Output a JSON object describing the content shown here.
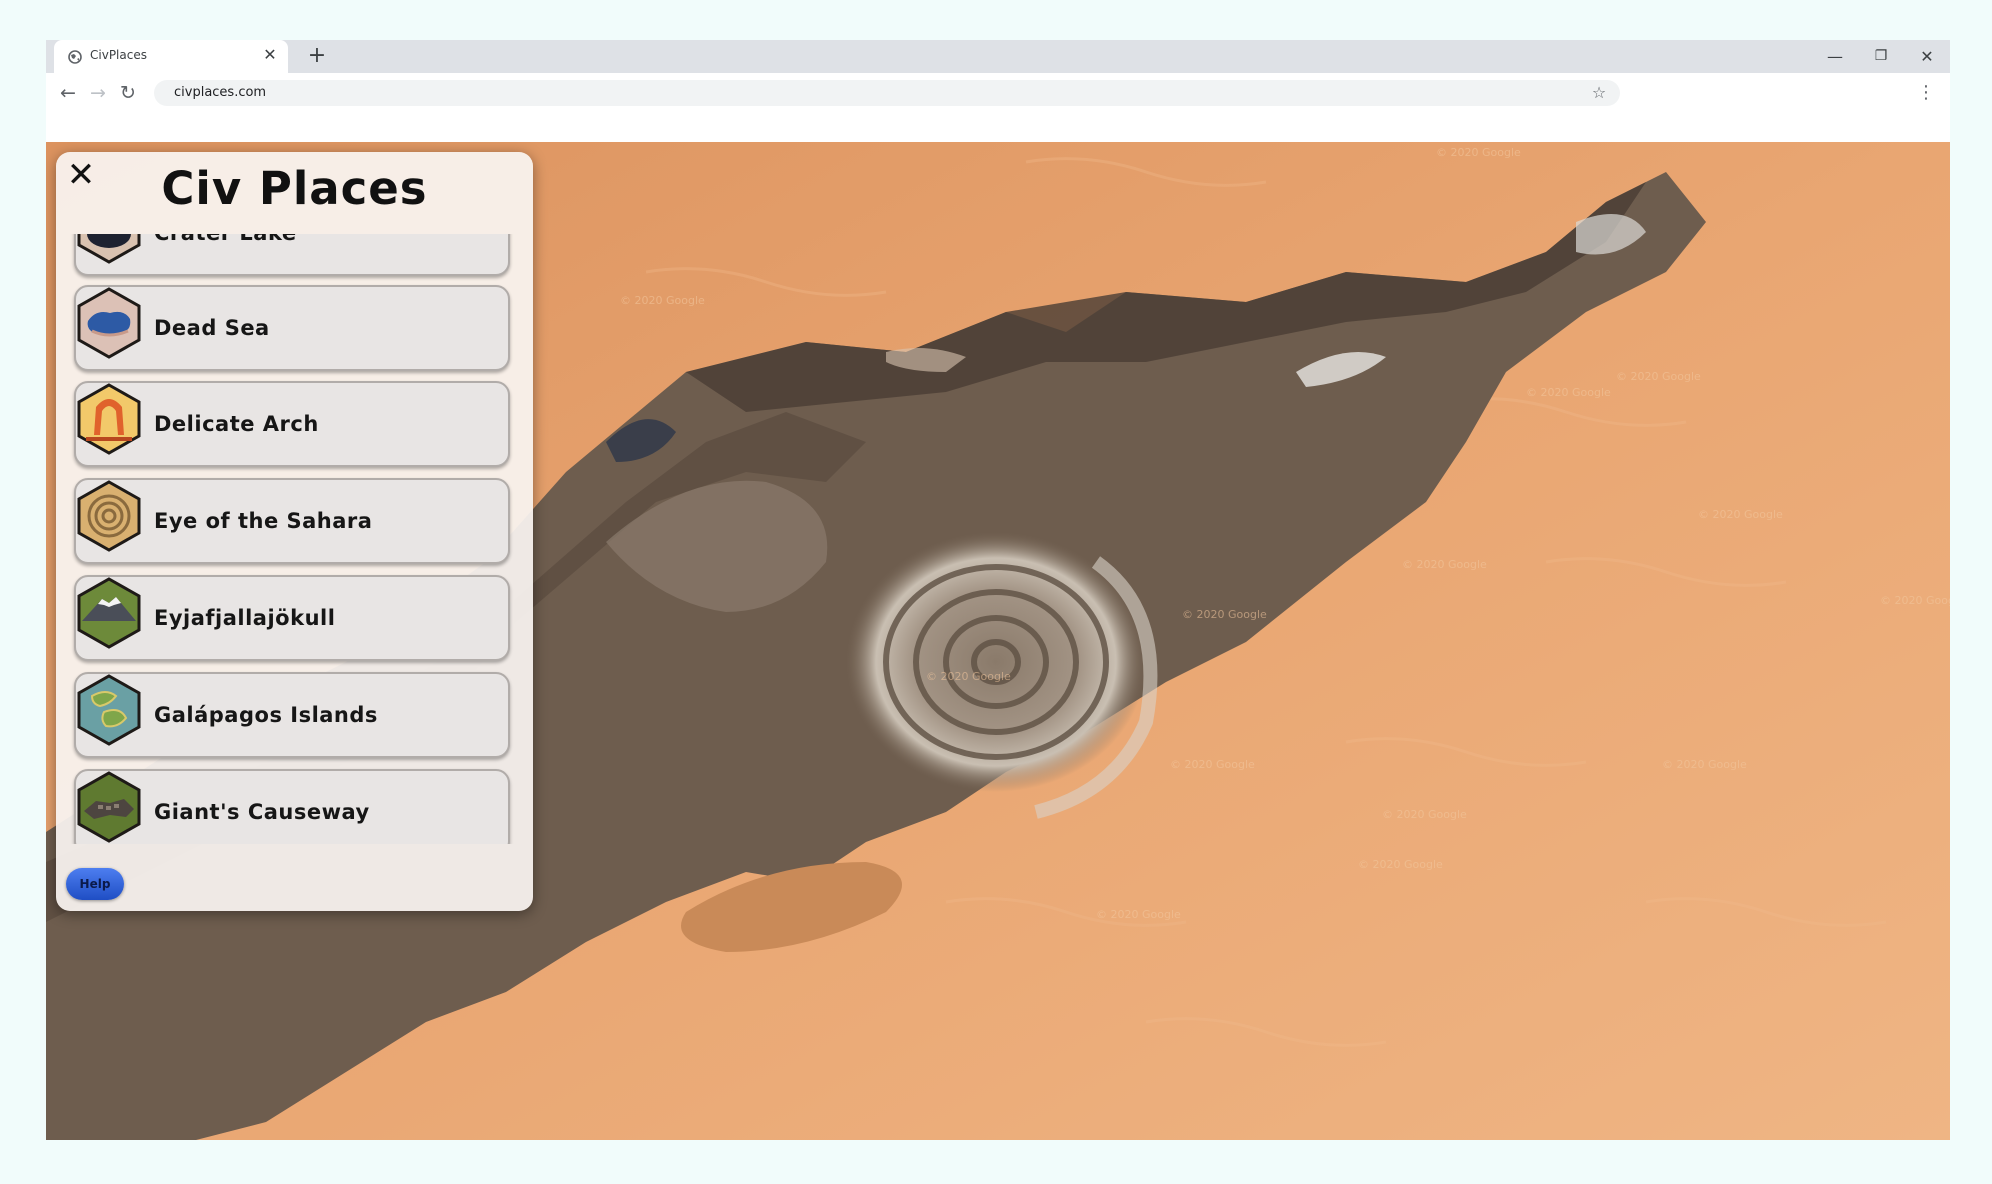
{
  "browser": {
    "tab_title": "CivPlaces",
    "url": "civplaces.com",
    "icons": {
      "favicon": "globe-icon",
      "tab_close": "close-icon",
      "new_tab": "plus-icon",
      "back": "arrow-left-icon",
      "forward": "arrow-right-icon",
      "reload": "reload-icon",
      "bookmark": "star-icon",
      "menu": "kebab-menu-icon",
      "minimize": "minimize-icon",
      "restore": "restore-icon",
      "close": "close-icon"
    },
    "glyphs": {
      "tab_close": "✕",
      "new_tab": "+",
      "back": "←",
      "forward": "→",
      "reload": "↻",
      "bookmark": "☆",
      "menu": "⋮",
      "minimize": "—",
      "restore": "❐",
      "close": "✕"
    }
  },
  "map": {
    "watermark": "© 2020 Google",
    "colors": {
      "sand": "#e6a26f",
      "rock": "#6d5c4c"
    }
  },
  "panel": {
    "title": "Civ Places",
    "close_glyph": "✕",
    "help_label": "Help",
    "places": [
      {
        "label": "Crater Lake",
        "icon": "crater-lake-icon"
      },
      {
        "label": "Dead Sea",
        "icon": "dead-sea-icon"
      },
      {
        "label": "Delicate Arch",
        "icon": "delicate-arch-icon"
      },
      {
        "label": "Eye of the Sahara",
        "icon": "eye-of-the-sahara-icon"
      },
      {
        "label": "Eyjafjallajökull",
        "icon": "eyjafjallajokull-icon"
      },
      {
        "label": "Galápagos Islands",
        "icon": "galapagos-islands-icon"
      },
      {
        "label": "Giant's Causeway",
        "icon": "giants-causeway-icon"
      }
    ],
    "colors": {
      "help_button": "#3563d8"
    }
  }
}
